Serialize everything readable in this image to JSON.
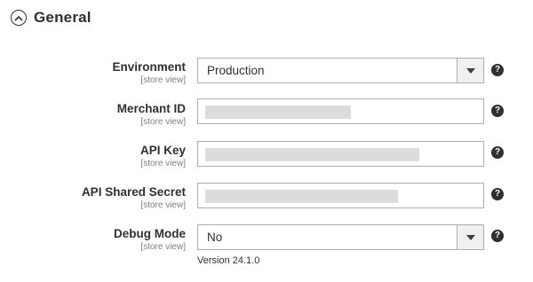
{
  "section": {
    "title": "General",
    "toggle_icon": "chevron-up-circle-icon"
  },
  "fields": {
    "environment": {
      "label": "Environment",
      "scope": "[store view]",
      "value": "Production"
    },
    "merchant_id": {
      "label": "Merchant ID",
      "scope": "[store view]",
      "value_masked": true
    },
    "api_key": {
      "label": "API Key",
      "scope": "[store view]",
      "value_masked": true
    },
    "api_shared_secret": {
      "label": "API Shared Secret",
      "scope": "[store view]",
      "value_masked": true
    },
    "debug_mode": {
      "label": "Debug Mode",
      "scope": "[store view]",
      "value": "No"
    }
  },
  "help_glyph": "?",
  "version": "Version 24.1.0",
  "colors": {
    "text": "#303030",
    "scope_text": "#808080",
    "border": "#adadad",
    "mask": "#dcdcdc"
  }
}
